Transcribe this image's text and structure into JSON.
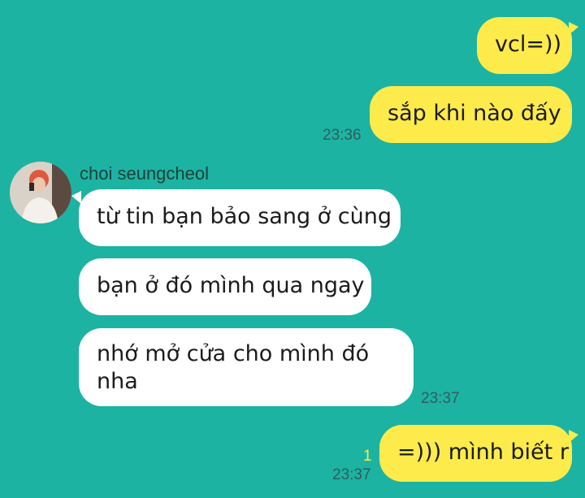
{
  "contact": {
    "name": "choi seungcheol"
  },
  "messages": [
    {
      "direction": "out",
      "text": "vcl=))"
    },
    {
      "direction": "out",
      "text": "sắp khi nào đấy",
      "time": "23:36"
    },
    {
      "direction": "in",
      "text": "từ tin bạn bảo sang ở cùng"
    },
    {
      "direction": "in",
      "text": "bạn ở đó mình qua ngay"
    },
    {
      "direction": "in",
      "text_line1": "nhớ mở cửa cho mình đó",
      "text_line2": "nha",
      "time": "23:37"
    },
    {
      "direction": "out",
      "text": "=))) mình biết r",
      "time": "23:37",
      "unread_count": "1"
    }
  ]
}
